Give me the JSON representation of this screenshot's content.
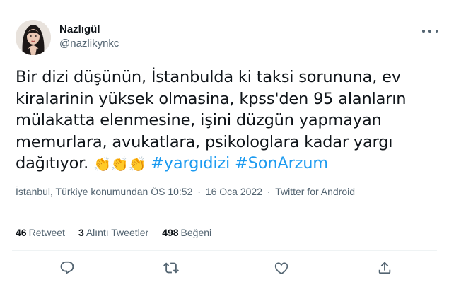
{
  "user": {
    "display_name": "Nazlıgül",
    "handle": "@nazlikynkc",
    "avatar_icon": "profile-photo"
  },
  "tweet": {
    "text_lines": [
      "Bir dizi düşünün, İstanbulda ki taksi sorununa, ev",
      "kiralarinin yüksek olmasina, kpss'den 95 alanların",
      "mülakatta elenmesine, işini düzgün yapmayan",
      "memurlara, avukatlara, psikologlara kadar yargı",
      "dağıtıyor."
    ],
    "emoji": "👏👏👏",
    "hashtags": [
      "#yargıdizi",
      "#SonArzum"
    ]
  },
  "meta": {
    "location": "İstanbul, Türkiye konumundan",
    "time": "ÖS 10:52",
    "date": "16 Oca 2022",
    "source": "Twitter for Android",
    "separator": "·"
  },
  "stats": {
    "retweets_count": "46",
    "retweets_label": "Retweet",
    "quotes_count": "3",
    "quotes_label": "Alıntı Tweetler",
    "likes_count": "498",
    "likes_label": "Beğeni"
  },
  "actions": [
    "reply-icon",
    "retweet-icon",
    "like-icon",
    "share-icon"
  ],
  "colors": {
    "hashtag": "#1d9bf0",
    "secondary_text": "#536471",
    "primary_text": "#0f1419",
    "divider": "#eff3f4"
  }
}
